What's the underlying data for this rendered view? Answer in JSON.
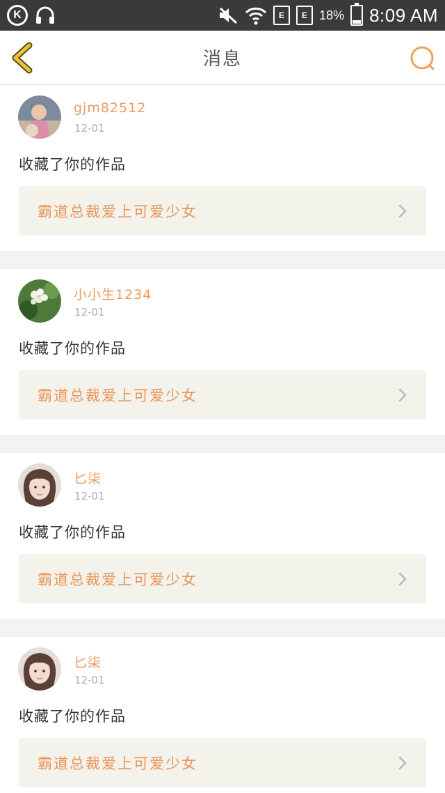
{
  "status_bar": {
    "sim1": "E",
    "sim2": "E",
    "battery_percent": "18%",
    "battery_level": 0.18,
    "time": "8:09 AM"
  },
  "header": {
    "title": "消息",
    "back_icon": "chevron-left-icon",
    "search_icon": "search-icon",
    "accent_color": "#e8a13a"
  },
  "messages": [
    {
      "username": "gjm82512",
      "date": "12-01",
      "action": "收藏了你的作品",
      "work_title": "霸道总裁爱上可爱少女",
      "avatar_icon": "avatar-woman-photo"
    },
    {
      "username": "小小生1234",
      "date": "12-01",
      "action": "收藏了你的作品",
      "work_title": "霸道总裁爱上可爱少女",
      "avatar_icon": "avatar-flower-photo"
    },
    {
      "username": "匕柒",
      "date": "12-01",
      "action": "收藏了你的作品",
      "work_title": "霸道总裁爱上可爱少女",
      "avatar_icon": "avatar-girl-photo"
    },
    {
      "username": "匕柒",
      "date": "12-01",
      "action": "收藏了你的作品",
      "work_title": "霸道总裁爱上可爱少女",
      "avatar_icon": "avatar-girl-photo"
    }
  ],
  "colors": {
    "username": "#ec9a60",
    "work_title": "#e9965a",
    "work_bg": "#f3f2eb",
    "page_bg": "#f3f3f3",
    "status_bg": "#3a3a3a"
  }
}
